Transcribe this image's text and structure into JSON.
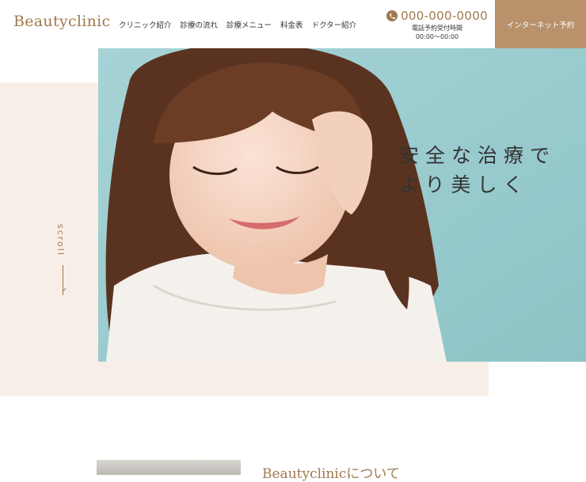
{
  "brand": {
    "logo": "Beautyclinic"
  },
  "nav": {
    "items": [
      "クリニック紹介",
      "診療の流れ",
      "診療メニュー",
      "料金表",
      "ドクター紹介"
    ]
  },
  "contact": {
    "phone_icon": "phone-icon",
    "phone": "000-000-0000",
    "hours_label": "電話予約受付時間",
    "hours": "00:00〜00:00"
  },
  "reserve": {
    "label": "インターネット予約"
  },
  "hero": {
    "catch_line1": "安全な治療で",
    "catch_line2": "より美しく",
    "scroll_label": "scroll"
  },
  "about": {
    "title": "Beautyclinicについて"
  },
  "colors": {
    "accent": "#a0784f",
    "button": "#b9926c",
    "band": "#f8eee8",
    "hero_bg": "#9dcdd0"
  }
}
